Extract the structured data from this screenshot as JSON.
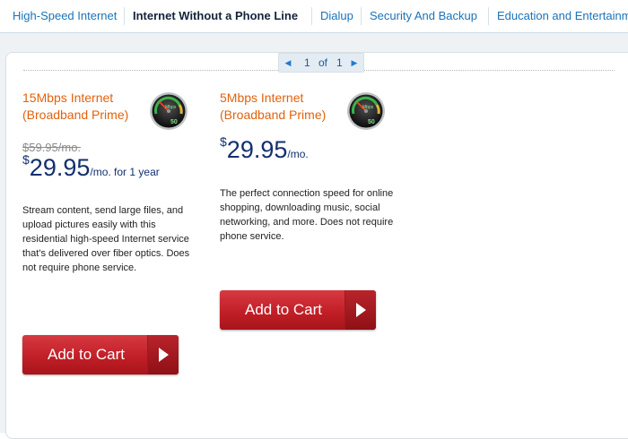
{
  "nav": {
    "tabs": [
      {
        "label": "High-Speed Internet"
      },
      {
        "label": "Internet Without a Phone Line"
      },
      {
        "label": "Dialup"
      },
      {
        "label": "Security And Backup"
      },
      {
        "label": "Education and Entertainm"
      }
    ]
  },
  "pager": {
    "prev_icon": "◀",
    "current": "1",
    "of_label": "of",
    "total": "1",
    "next_icon": "▶"
  },
  "products": [
    {
      "name_line1": "15Mbps Internet",
      "name_line2": "(Broadband Prime)",
      "gauge_label": "Mbps",
      "gauge_value": "50",
      "old_price": "$59.95/mo.",
      "currency": "$",
      "price": "29.95",
      "price_suffix": "/mo. for 1 year",
      "description": "Stream content, send large files, and upload pictures easily with this residential high-speed Internet service that's delivered over fiber optics. Does not require phone service.",
      "button_label": "Add to Cart"
    },
    {
      "name_line1": "5Mbps Internet",
      "name_line2": "(Broadband Prime)",
      "gauge_label": "Mbps",
      "gauge_value": "50",
      "currency": "$",
      "price": "29.95",
      "price_suffix": "/mo.",
      "description": "The perfect connection speed for online shopping, downloading music, social networking, and more. Does not require phone service.",
      "button_label": "Add to Cart"
    }
  ]
}
